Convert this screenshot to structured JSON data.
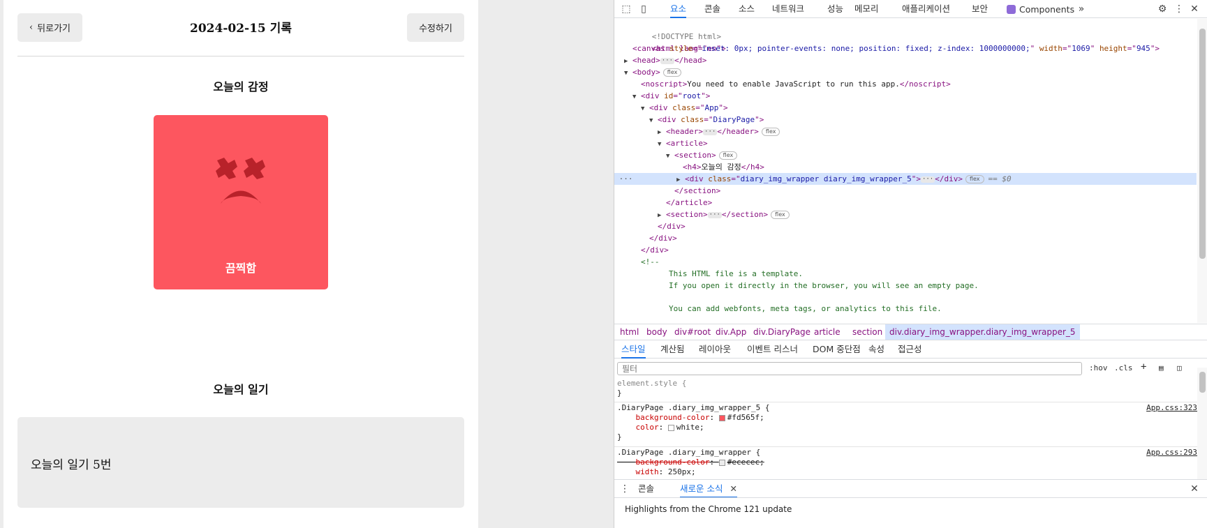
{
  "app": {
    "back_label": "뒤로가기",
    "date_title": "2024-02-15 기록",
    "edit_label": "수정하기",
    "emotion_title": "오늘의 감정",
    "emotion_label": "끔찍함",
    "emotion_color": "#fd565f",
    "diary_title": "오늘의 일기",
    "diary_content": "오늘의 일기 5번"
  },
  "devtools": {
    "tabs": [
      "요소",
      "콘솔",
      "소스",
      "네트워크",
      "성능",
      "메모리",
      "애플리케이션",
      "보안",
      "Components"
    ],
    "active_tab": "요소",
    "dom": {
      "doctype": "<!DOCTYPE html>",
      "html_open": "<html lang=\"en\">",
      "canvas_style": "inset: 0px; pointer-events: none; position: fixed; z-index: 1000000000;",
      "canvas_width": "1069",
      "canvas_height": "945",
      "noscript_text": "You need to enable JavaScript to run this app.",
      "h4_text": "오늘의 감정",
      "selected_class": "diary_img_wrapper diary_img_wrapper_5",
      "selected_marker": "== $0",
      "flex_badge": "flex",
      "comment_open": "<!--",
      "comment_lines": [
        "This HTML file is a template.",
        "If you open it directly in the browser, you will see an empty page.",
        "You can add webfonts, meta tags, or analytics to this file."
      ]
    },
    "breadcrumbs": [
      "html",
      "body",
      "div#root",
      "div.App",
      "div.DiaryPage",
      "article",
      "section",
      "div.diary_img_wrapper.diary_img_wrapper_5"
    ],
    "styles_tabs": [
      "스타일",
      "계산됨",
      "레이아웃",
      "이벤트 리스너",
      "DOM 중단점",
      "속성",
      "접근성"
    ],
    "filter_placeholder": "필터",
    "filter_buttons": [
      ":hov",
      ".cls"
    ],
    "rules": [
      {
        "selector": "element.style {",
        "close": "}"
      },
      {
        "selector": ".DiaryPage .diary_img_wrapper_5 {",
        "source": "App.css:323",
        "p1": "background-color",
        "v1": "#fd565f;",
        "c1": "#fd565f",
        "p2": "color",
        "v2": "white;",
        "c2": "#ffffff",
        "close": "}"
      },
      {
        "selector": ".DiaryPage .diary_img_wrapper {",
        "source": "App.css:293",
        "p1": "background-color",
        "v1": "#ececec;",
        "c1": "#ececec",
        "p2": "width",
        "v2": "250px;"
      }
    ],
    "drawer_tabs": [
      "콘솔",
      "새로운 소식"
    ],
    "whats_new": "Highlights from the Chrome 121 update"
  }
}
